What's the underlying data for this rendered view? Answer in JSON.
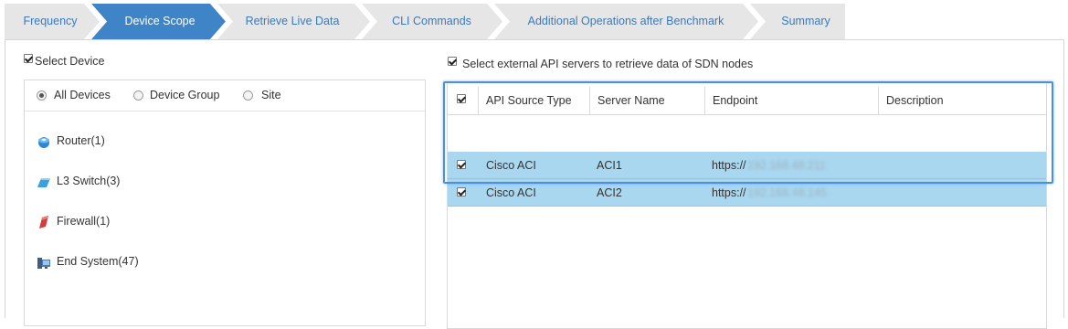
{
  "wizard": {
    "steps": [
      {
        "label": "Frequency",
        "active": false
      },
      {
        "label": "Device Scope",
        "active": true
      },
      {
        "label": "Retrieve Live Data",
        "active": false
      },
      {
        "label": "CLI Commands",
        "active": false
      },
      {
        "label": "Additional Operations after Benchmark",
        "active": false
      },
      {
        "label": "Summary",
        "active": false
      }
    ],
    "colors": {
      "active": "#3f84c6",
      "inactive": "#e6e6e6",
      "text": "#3d7ab8"
    }
  },
  "device_scope": {
    "select_device_label": "Select Device",
    "select_device_checked": true,
    "radios": [
      {
        "label": "All Devices",
        "checked": true
      },
      {
        "label": "Device Group",
        "checked": false
      },
      {
        "label": "Site",
        "checked": false
      }
    ],
    "devices": [
      {
        "label": "Router(1)",
        "icon": "router-icon"
      },
      {
        "label": "L3 Switch(3)",
        "icon": "l3-switch-icon"
      },
      {
        "label": "Firewall(1)",
        "icon": "firewall-icon"
      },
      {
        "label": "End System(47)",
        "icon": "end-system-icon"
      }
    ]
  },
  "api_servers": {
    "select_label": "Select external API servers to retrieve data of SDN nodes",
    "select_checked": true,
    "columns": [
      "API Source Type",
      "Server Name",
      "Endpoint",
      "Description"
    ],
    "rows": [
      {
        "checked": true,
        "source_type": "Cisco ACI",
        "server_name": "ACI1",
        "endpoint_prefix": "https://",
        "endpoint_host": "192.168.48.211",
        "description": ""
      },
      {
        "checked": true,
        "source_type": "Cisco ACI",
        "server_name": "ACI2",
        "endpoint_prefix": "https://",
        "endpoint_host": "192.168.48.145",
        "description": ""
      }
    ],
    "row_highlight_color": "#a9d7f0",
    "callout_color": "#4a8fe0"
  }
}
